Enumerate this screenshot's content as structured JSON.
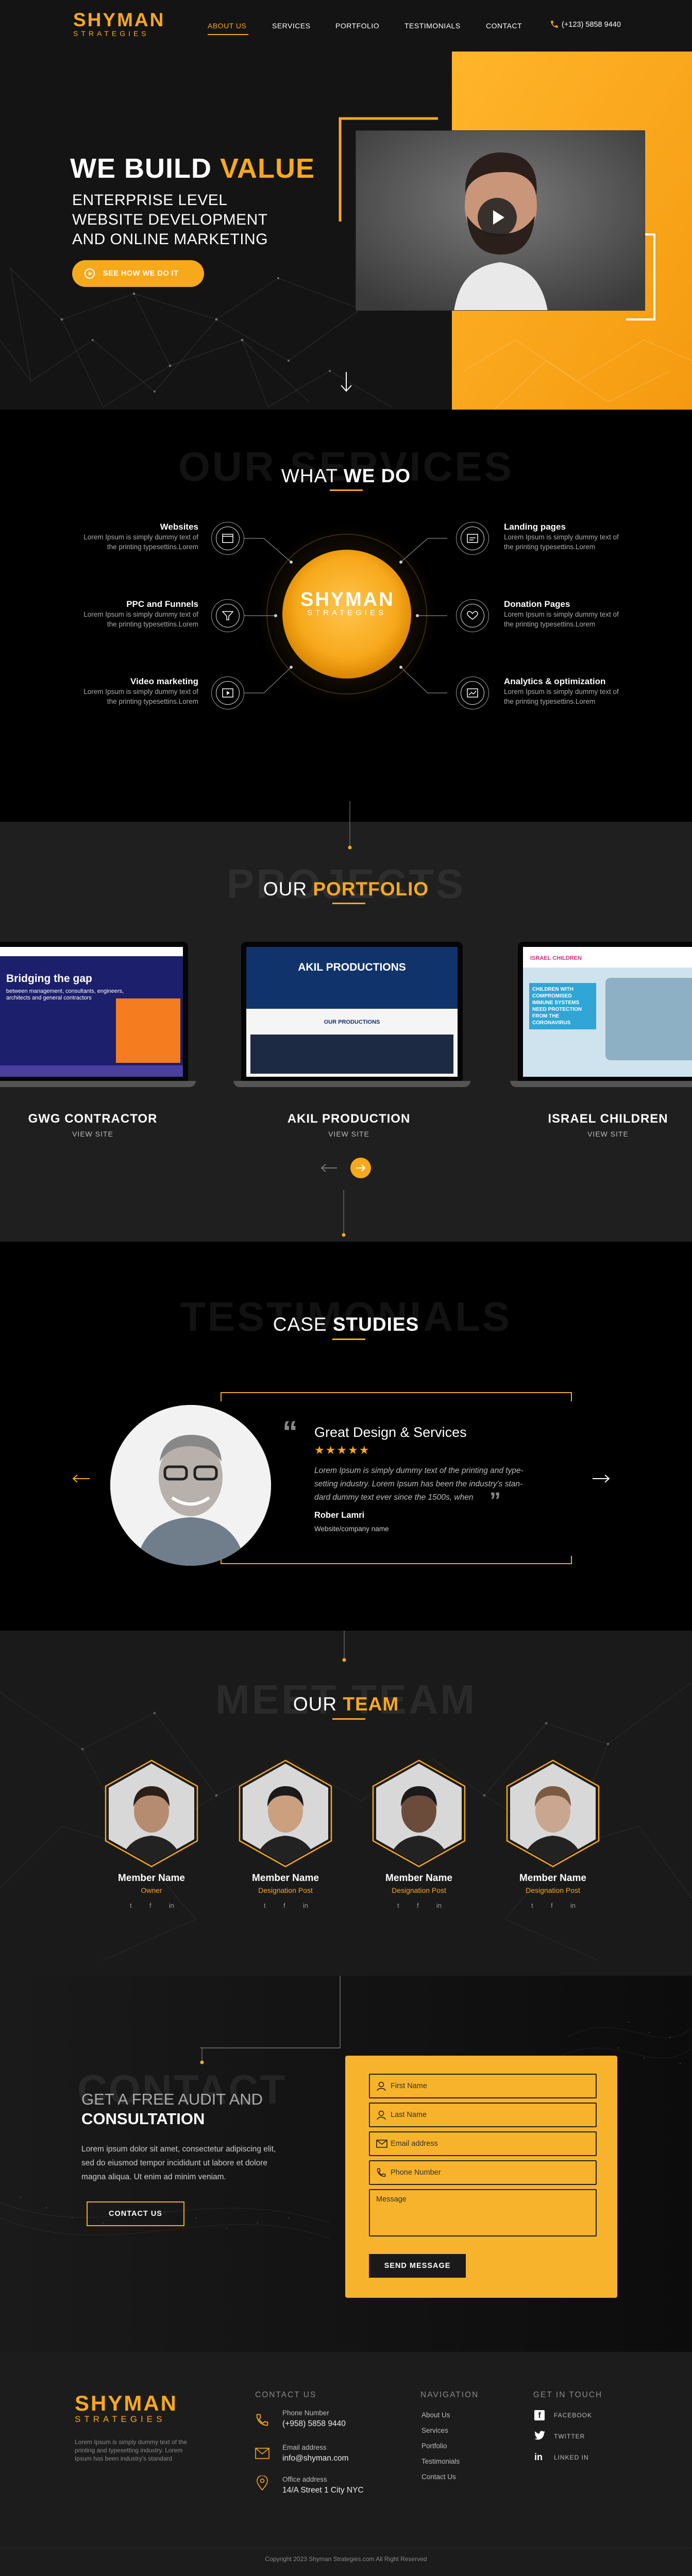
{
  "header": {
    "logo_top": "SHYMAN",
    "logo_bottom": "STRATEGIES",
    "nav": [
      "ABOUT US",
      "SERVICES",
      "PORTFOLIO",
      "TESTIMONIALS",
      "CONTACT"
    ],
    "phone": "(+123) 5858 9440"
  },
  "hero": {
    "title_white": "WE BUILD",
    "title_gold": "VALUE",
    "subtitle_lines": [
      "ENTERPRISE LEVEL",
      "WEBSITE DEVELOPMENT",
      "AND ONLINE MARKETING"
    ],
    "cta": "SEE HOW WE DO IT"
  },
  "services": {
    "big": "OUR SERVICES",
    "title_white": "WHAT",
    "title_bold": "WE DO",
    "center_logo_top": "SHYMAN",
    "center_logo_bottom": "STRATEGIES",
    "items": [
      {
        "title": "Websites",
        "text_1": "Lorem Ipsum is simply dummy text of",
        "text_2": "the printing typesettins.Lorem"
      },
      {
        "title": "PPC and Funnels",
        "text_1": "Lorem Ipsum is simply dummy text of",
        "text_2": "the printing typesettins.Lorem"
      },
      {
        "title": "Video marketing",
        "text_1": "Lorem Ipsum is simply dummy text of",
        "text_2": "the printing typesettins.Lorem"
      },
      {
        "title": "Landing pages",
        "text_1": "Lorem Ipsum is simply dummy text of",
        "text_2": "the printing typesettins.Lorem"
      },
      {
        "title": "Donation Pages",
        "text_1": "Lorem Ipsum is simply dummy text of",
        "text_2": "the printing typesettins.Lorem"
      },
      {
        "title": "Analytics & optimization",
        "text_1": "Lorem Ipsum is simply dummy text of",
        "text_2": "the printing typesettins.Lorem"
      }
    ]
  },
  "portfolio": {
    "big": "PROJECTS",
    "title_white": "OUR",
    "title_bold": "PORTFOLIO",
    "items": [
      {
        "name": "GWG CONTRACTOR",
        "link": "VIEW SITE",
        "screen_title": "Bridging the gap",
        "screen_sub": "between management, consultants, engineers, architects and general contractors"
      },
      {
        "name": "AKIL PRODUCTION",
        "link": "VIEW SITE",
        "screen_title": "AKIL PRODUCTIONS",
        "screen_sub": "OUR PRODUCTIONS"
      },
      {
        "name": "ISRAEL CHILDREN",
        "link": "VIEW SITE",
        "screen_title": "CHILDREN WITH COMPROMISED IMMUNE SYSTEMS NEED PROTECTION FROM THE CORONAVIRUS",
        "screen_sub": "ISRAEL CHILDREN"
      }
    ]
  },
  "testimonials": {
    "big": "TESTIMONIALS",
    "title_white": "CASE",
    "title_bold": "STUDIES",
    "quote_title": "Great Design & Services",
    "stars": 5,
    "quote_lines": [
      "Lorem Ipsum is simply dummy text of the printing and type-",
      "setting industry. Lorem Ipsum has been the industry's stan-",
      "dard dummy text ever since the 1500s, when"
    ],
    "author": "Rober  Lamri",
    "author_role": "Website/company name"
  },
  "team": {
    "big": "MEET TEAM",
    "title_white": "OUR",
    "title_bold": "TEAM",
    "members": [
      {
        "name": "Member Name",
        "role": "Owner"
      },
      {
        "name": "Member Name",
        "role": "Designation Post"
      },
      {
        "name": "Member Name",
        "role": "Designation Post"
      },
      {
        "name": "Member Name",
        "role": "Designation Post"
      }
    ]
  },
  "contact": {
    "big": "CONTACT",
    "title_line1": "GET A FREE AUDIT AND",
    "title_line2": "CONSULTATION",
    "text_lines": [
      "Lorem ipsum dolor sit amet, consectetur adipiscing elit,",
      "sed do eiusmod tempor incididunt ut labore et dolore",
      "magna aliqua. Ut enim ad minim veniam."
    ],
    "button": "CONTACT US",
    "form": {
      "first_name": "First Name",
      "last_name": "Last Name",
      "email": "Email address",
      "phone": "Phone Number",
      "message": "Message",
      "submit": "SEND MESSAGE"
    }
  },
  "footer": {
    "logo_top": "SHYMAN",
    "logo_bottom": "STRATEGIES",
    "about_lines": [
      "Lorem Ipsum is simply dummy text of the",
      "printing and typesetting industry. Lorem",
      "Ipsum has been industry's standard"
    ],
    "contact_heading": "CONTACT US",
    "phone_label": "Phone Number",
    "phone": "(+958) 5858 9440",
    "email_label": "Email address",
    "email": "info@shyman.com",
    "office_label": "Office address",
    "office": "14/A Street 1 City NYC",
    "nav_heading": "NAVIGATION",
    "nav": [
      "About Us",
      "Services",
      "Portfolio",
      "Testimonials",
      "Contact Us"
    ],
    "social_heading": "GET IN TOUCH",
    "social": [
      "FACEBOOK",
      "TWITTER",
      "LINKED IN"
    ],
    "copyright": "Copyright 2023 Shyman Strategies.com All Right Reserved"
  },
  "colors": {
    "accent": "#f7a91c",
    "dark": "#0d0d0d",
    "panel": "#1a1a1a"
  }
}
